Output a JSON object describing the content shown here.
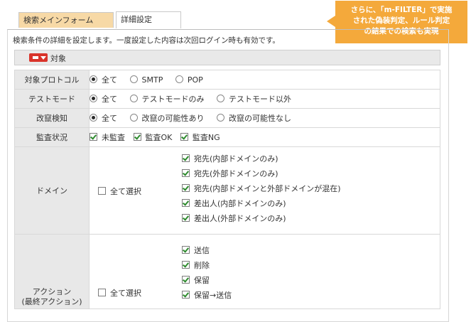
{
  "tabs": [
    {
      "label": "検索メインフォーム"
    },
    {
      "label": "詳細設定"
    }
  ],
  "callout": {
    "line1": "さらに、「m-FILTER」で実施",
    "line2": "された偽装判定、ルール判定",
    "line3": "の結果での検索も実現"
  },
  "description": "検索条件の詳細を設定します。一度設定した内容は次回ログイン時も有効です。",
  "section": {
    "label": "対象"
  },
  "rows": {
    "protocol": {
      "label": "対象プロトコル",
      "options": [
        "全て",
        "SMTP",
        "POP"
      ],
      "selected": 0
    },
    "testmode": {
      "label": "テストモード",
      "options": [
        "全て",
        "テストモードのみ",
        "テストモード以外"
      ],
      "selected": 0
    },
    "tamper": {
      "label": "改竄検知",
      "options": [
        "全て",
        "改竄の可能性あり",
        "改竄の可能性なし"
      ],
      "selected": 0
    },
    "audit": {
      "label": "監査状況",
      "options": [
        "未監査",
        "監査OK",
        "監査NG"
      ],
      "checked": [
        true,
        true,
        true
      ]
    },
    "domain": {
      "label": "ドメイン",
      "select_all": "全て選択",
      "items": [
        "宛先(内部ドメインのみ)",
        "宛先(外部ドメインのみ)",
        "宛先(内部ドメインと外部ドメインが混在)",
        "差出人(内部ドメインのみ)",
        "差出人(外部ドメインのみ)"
      ],
      "checked": [
        true,
        true,
        true,
        true,
        true
      ]
    },
    "action": {
      "label_line1": "アクション",
      "label_line2": "(最終アクション)",
      "select_all": "全て選択",
      "items": [
        "送信",
        "削除",
        "保留",
        "保留→送信"
      ],
      "checked": [
        true,
        true,
        true,
        true
      ]
    }
  },
  "colors": {
    "accent": "#f4a93b",
    "tab_active": "#f7d9a6",
    "label_bg": "#e8e8e8"
  }
}
